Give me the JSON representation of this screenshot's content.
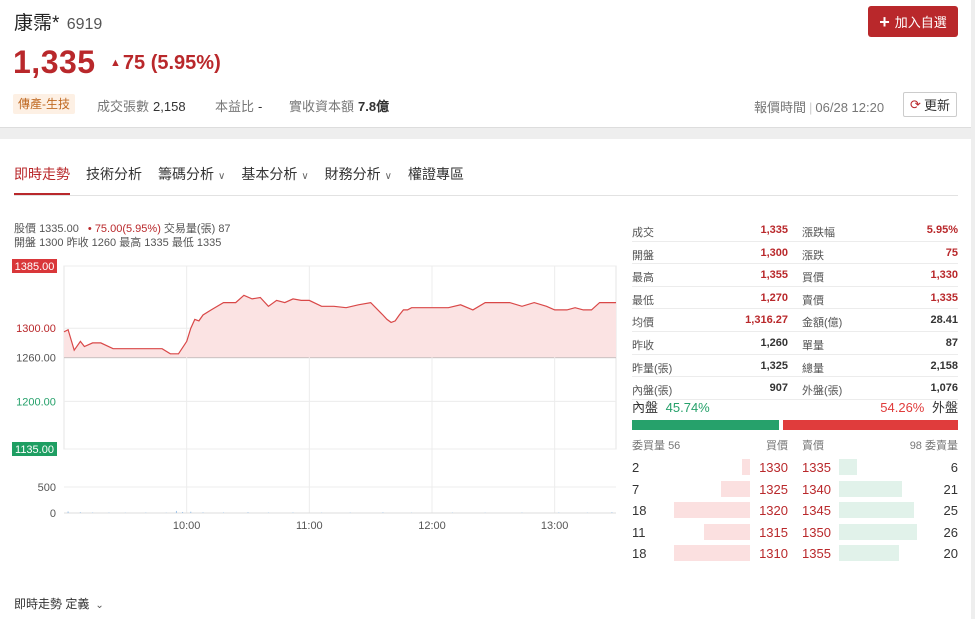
{
  "header": {
    "name": "康霈*",
    "code": "6919",
    "add_button": "加入自選",
    "price": "1,335",
    "change": "75",
    "change_pct": "(5.95%)",
    "sector": "傳產-生技",
    "volume_label": "成交張數",
    "volume_value": "2,158",
    "pe_label": "本益比",
    "pe_value": "-",
    "capital_label": "實收資本額",
    "capital_value": "7.8億",
    "quote_time_label": "報價時間",
    "quote_time_value": "06/28 12:20",
    "refresh_label": "更新"
  },
  "tabs": [
    {
      "label": "即時走勢",
      "active": true
    },
    {
      "label": "技術分析"
    },
    {
      "label": "籌碼分析",
      "dropdown": true
    },
    {
      "label": "基本分析",
      "dropdown": true
    },
    {
      "label": "財務分析",
      "dropdown": true
    },
    {
      "label": "權證專區"
    }
  ],
  "summary": {
    "price_label": "股價",
    "price": "1335.00",
    "change": "75.00(5.95%)",
    "vol_label": "交易量(張)",
    "vol": "87",
    "open_label": "開盤",
    "open": "1300",
    "prev_label": "昨收",
    "prev": "1260",
    "high_label": "最高",
    "high": "1335",
    "low_label": "最低",
    "low": "1335"
  },
  "footer_label": "即時走勢 定義",
  "chart_data": {
    "type": "line",
    "y_ticks": [
      "1385.00",
      "1300.00",
      "1260.00",
      "1200.00",
      "1135.00"
    ],
    "y_tick_values": [
      1385,
      1300,
      1260,
      1200,
      1135
    ],
    "ylim": [
      1135,
      1385
    ],
    "volume_ticks": [
      "500",
      "0"
    ],
    "volume_tick_values": [
      500,
      0
    ],
    "x_ticks": [
      "10:00",
      "11:00",
      "12:00",
      "13:00"
    ],
    "x_tick_values": [
      60,
      120,
      180,
      240
    ],
    "xlim": [
      0,
      270
    ],
    "reference": 1260,
    "series": [
      {
        "x": [
          0,
          2,
          5,
          8,
          10,
          14,
          18,
          24,
          30,
          36,
          42,
          48,
          52,
          56,
          60,
          62,
          64,
          66,
          68,
          72,
          78,
          84,
          88,
          92,
          96,
          100,
          104,
          108,
          112,
          116,
          120,
          126,
          132,
          138,
          144,
          150,
          156,
          158,
          160,
          162,
          164,
          166,
          168,
          170,
          176,
          182,
          188,
          194,
          200,
          206,
          212,
          218,
          224,
          230,
          236,
          240,
          242,
          246,
          250,
          254,
          258,
          262,
          266,
          270
        ],
        "y": [
          1295,
          1298,
          1270,
          1282,
          1275,
          1280,
          1280,
          1272,
          1272,
          1272,
          1272,
          1272,
          1265,
          1265,
          1282,
          1300,
          1312,
          1310,
          1318,
          1325,
          1335,
          1335,
          1345,
          1340,
          1342,
          1330,
          1338,
          1335,
          1340,
          1338,
          1338,
          1330,
          1330,
          1328,
          1332,
          1335,
          1318,
          1312,
          1308,
          1310,
          1318,
          1325,
          1325,
          1328,
          1328,
          1328,
          1328,
          1332,
          1325,
          1335,
          1335,
          1335,
          1330,
          1335,
          1330,
          1325,
          1325,
          1325,
          1328,
          1325,
          1325,
          1335,
          1335,
          1335
        ]
      }
    ],
    "volume": [
      {
        "x": 2,
        "v": 30
      },
      {
        "x": 8,
        "v": 15
      },
      {
        "x": 14,
        "v": 10
      },
      {
        "x": 22,
        "v": 8
      },
      {
        "x": 30,
        "v": 6
      },
      {
        "x": 40,
        "v": 8
      },
      {
        "x": 50,
        "v": 6
      },
      {
        "x": 55,
        "v": 40
      },
      {
        "x": 58,
        "v": 20
      },
      {
        "x": 62,
        "v": 25
      },
      {
        "x": 68,
        "v": 12
      },
      {
        "x": 78,
        "v": 10
      },
      {
        "x": 90,
        "v": 14
      },
      {
        "x": 100,
        "v": 8
      },
      {
        "x": 112,
        "v": 10
      },
      {
        "x": 126,
        "v": 6
      },
      {
        "x": 140,
        "v": 8
      },
      {
        "x": 156,
        "v": 12
      },
      {
        "x": 170,
        "v": 6
      },
      {
        "x": 190,
        "v": 8
      },
      {
        "x": 206,
        "v": 6
      },
      {
        "x": 224,
        "v": 8
      },
      {
        "x": 242,
        "v": 10
      },
      {
        "x": 256,
        "v": 6
      },
      {
        "x": 268,
        "v": 14
      }
    ]
  },
  "stats": [
    {
      "l1": "成交",
      "v1": "1,335",
      "c1": "red",
      "l2": "漲跌幅",
      "v2": "5.95%",
      "c2": "red"
    },
    {
      "l1": "開盤",
      "v1": "1,300",
      "c1": "red",
      "l2": "漲跌",
      "v2": "75",
      "c2": "red"
    },
    {
      "l1": "最高",
      "v1": "1,355",
      "c1": "red",
      "l2": "買價",
      "v2": "1,330",
      "c2": "red"
    },
    {
      "l1": "最低",
      "v1": "1,270",
      "c1": "red",
      "l2": "賣價",
      "v2": "1,335",
      "c2": "red"
    },
    {
      "l1": "均價",
      "v1": "1,316.27",
      "c1": "red",
      "l2": "金額(億)",
      "v2": "28.41",
      "c2": ""
    },
    {
      "l1": "昨收",
      "v1": "1,260",
      "c1": "",
      "l2": "單量",
      "v2": "87",
      "c2": ""
    },
    {
      "l1": "昨量(張)",
      "v1": "1,325",
      "c1": "",
      "l2": "總量",
      "v2": "2,158",
      "c2": ""
    },
    {
      "l1": "內盤(張)",
      "v1": "907",
      "c1": "",
      "l2": "外盤(張)",
      "v2": "1,076",
      "c2": ""
    }
  ],
  "ratio": {
    "inner_label": "內盤",
    "inner_pct": "45.74%",
    "inner_value": 45.74,
    "outer_pct": "54.26%",
    "outer_label": "外盤",
    "outer_value": 54.26,
    "inner_color": "#26a16b",
    "outer_color": "#e03c3c"
  },
  "orderbook": {
    "bid_vol_label": "委買量",
    "bid_total": "56",
    "bid_price_label": "買價",
    "ask_price_label": "賣價",
    "ask_total": "98",
    "ask_vol_label": "委賣量",
    "rows": [
      {
        "bid_vol": "2",
        "bid_price": "1330",
        "ask_price": "1335",
        "ask_vol": "6",
        "bid_n": 2,
        "ask_n": 6
      },
      {
        "bid_vol": "7",
        "bid_price": "1325",
        "ask_price": "1340",
        "ask_vol": "21",
        "bid_n": 7,
        "ask_n": 21
      },
      {
        "bid_vol": "18",
        "bid_price": "1320",
        "ask_price": "1345",
        "ask_vol": "25",
        "bid_n": 18,
        "ask_n": 25
      },
      {
        "bid_vol": "11",
        "bid_price": "1315",
        "ask_price": "1350",
        "ask_vol": "26",
        "bid_n": 11,
        "ask_n": 26
      },
      {
        "bid_vol": "18",
        "bid_price": "1310",
        "ask_price": "1355",
        "ask_vol": "20",
        "bid_n": 18,
        "ask_n": 20
      }
    ]
  }
}
